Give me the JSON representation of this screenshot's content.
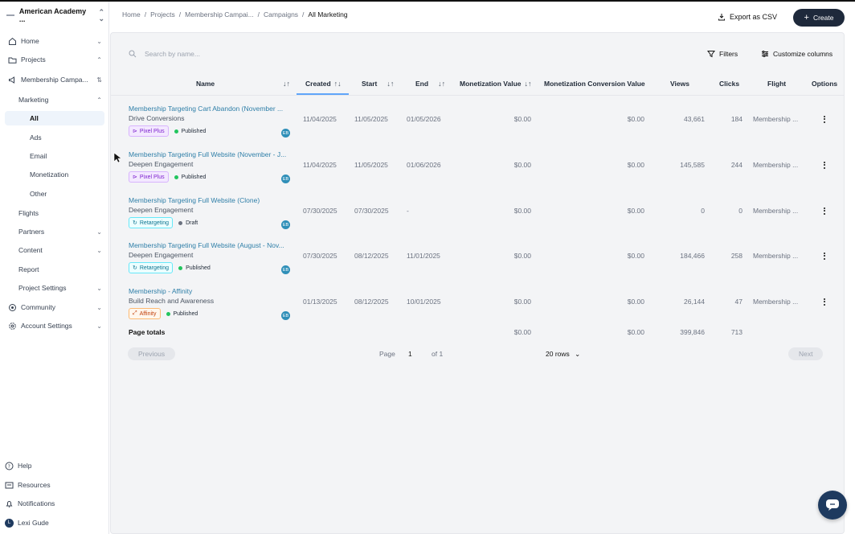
{
  "org": {
    "name": "American Academy ..."
  },
  "sidebar": {
    "items": [
      {
        "label": "Home",
        "icon": "home-icon",
        "chevron": "⌄"
      },
      {
        "label": "Projects",
        "icon": "projects-icon",
        "chevron": "⌃"
      },
      {
        "label": "Membership Campa...",
        "icon": "campaign-icon",
        "chevron": "⇅"
      },
      {
        "label": "Marketing",
        "chevron": "⌃"
      },
      {
        "label": "All"
      },
      {
        "label": "Ads"
      },
      {
        "label": "Email"
      },
      {
        "label": "Monetization"
      },
      {
        "label": "Other"
      },
      {
        "label": "Flights"
      },
      {
        "label": "Partners",
        "chevron": "⌄"
      },
      {
        "label": "Content",
        "chevron": "⌄"
      },
      {
        "label": "Report"
      },
      {
        "label": "Project Settings",
        "chevron": "⌄"
      },
      {
        "label": "Community",
        "icon": "community-icon",
        "chevron": "⌄"
      },
      {
        "label": "Account Settings",
        "icon": "settings-icon",
        "chevron": "⌄"
      }
    ],
    "footer": [
      {
        "label": "Help",
        "icon": "help-icon"
      },
      {
        "label": "Resources",
        "icon": "resources-icon"
      },
      {
        "label": "Notifications",
        "icon": "bell-icon"
      },
      {
        "label": "Lexi Gude",
        "icon": "avatar-icon",
        "initial": "L"
      }
    ]
  },
  "breadcrumb": [
    "Home",
    "/",
    "Projects",
    "/",
    "Membership Campai...",
    "/",
    "Campaigns",
    "/",
    "All Marketing"
  ],
  "header": {
    "export_label": "Export as CSV",
    "create_label": "Create"
  },
  "toolbar": {
    "search_placeholder": "Search by name...",
    "filters_label": "Filters",
    "columns_label": "Customize columns"
  },
  "table": {
    "columns": [
      "Name",
      "Created",
      "Start",
      "End",
      "Monetization Value",
      "Monetization Conversion Value",
      "Views",
      "Clicks",
      "Flight",
      "Options"
    ],
    "rows": [
      {
        "title": "Membership Targeting Cart Abandon (November ...",
        "goal": "Drive Conversions",
        "tag": "Pixel Plus",
        "tag_type": "pixel",
        "status": "Published",
        "status_color": "#22c55e",
        "avatar": "EB",
        "created": "11/04/2025",
        "start": "11/05/2025",
        "end": "01/05/2026",
        "mon_value": "$0.00",
        "mon_conv": "$0.00",
        "views": "43,661",
        "clicks": "184",
        "flight": "Membership ..."
      },
      {
        "title": "Membership Targeting Full Website (November - J...",
        "goal": "Deepen Engagement",
        "tag": "Pixel Plus",
        "tag_type": "pixel",
        "status": "Published",
        "status_color": "#22c55e",
        "avatar": "EB",
        "created": "11/04/2025",
        "start": "11/05/2025",
        "end": "01/06/2026",
        "mon_value": "$0.00",
        "mon_conv": "$0.00",
        "views": "145,585",
        "clicks": "244",
        "flight": "Membership ..."
      },
      {
        "title": "Membership Targeting Full Website (Clone)",
        "goal": "Deepen Engagement",
        "tag": "Retargeting",
        "tag_type": "retarget",
        "status": "Draft",
        "status_color": "#6b7280",
        "avatar": "EB",
        "created": "07/30/2025",
        "start": "07/30/2025",
        "end": "-",
        "mon_value": "$0.00",
        "mon_conv": "$0.00",
        "views": "0",
        "clicks": "0",
        "flight": "Membership ..."
      },
      {
        "title": "Membership Targeting Full Website (August - Nov...",
        "goal": "Deepen Engagement",
        "tag": "Retargeting",
        "tag_type": "retarget",
        "status": "Published",
        "status_color": "#22c55e",
        "avatar": "EB",
        "created": "07/30/2025",
        "start": "08/12/2025",
        "end": "11/01/2025",
        "mon_value": "$0.00",
        "mon_conv": "$0.00",
        "views": "184,466",
        "clicks": "258",
        "flight": "Membership ..."
      },
      {
        "title": "Membership - Affinity",
        "goal": "Build Reach and Awareness",
        "tag": "Affinity",
        "tag_type": "affinity",
        "status": "Published",
        "status_color": "#22c55e",
        "avatar": "EB",
        "created": "01/13/2025",
        "start": "08/12/2025",
        "end": "10/01/2025",
        "mon_value": "$0.00",
        "mon_conv": "$0.00",
        "views": "26,144",
        "clicks": "47",
        "flight": "Membership ..."
      }
    ],
    "totals": {
      "label": "Page totals",
      "mon_value": "$0.00",
      "mon_conv": "$0.00",
      "views": "399,846",
      "clicks": "713"
    }
  },
  "pagination": {
    "prev": "Previous",
    "page_label": "Page",
    "page": "1",
    "of": "of 1",
    "rows": "20 rows",
    "next": "Next"
  }
}
